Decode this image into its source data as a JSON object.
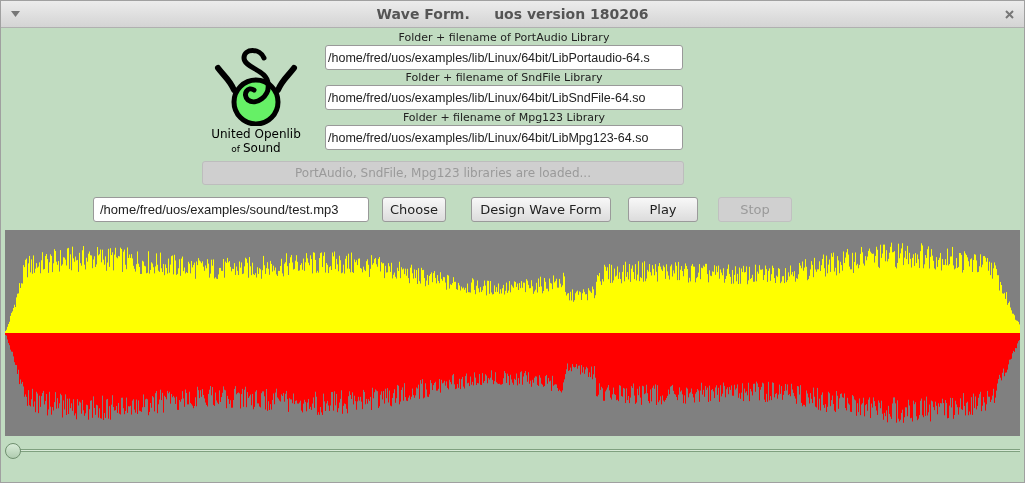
{
  "window": {
    "title": "Wave Form.     uos version 180206"
  },
  "logo": {
    "line_1": "United Openlib",
    "line_2_small": "of",
    "line_2": "Sound"
  },
  "libraries": [
    {
      "label": "Folder + filename of PortAudio Library",
      "value": "/home/fred/uos/examples/lib/Linux/64bit/LibPortaudio-64.s"
    },
    {
      "label": "Folder + filename of SndFile Library",
      "value": "/home/fred/uos/examples/lib/Linux/64bit/LibSndFile-64.so"
    },
    {
      "label": "Folder + filename of Mpg123 Library",
      "value": "/home/fred/uos/examples/lib/Linux/64bit/LibMpg123-64.so"
    }
  ],
  "load_button": {
    "label": "PortAudio, SndFile, Mpg123  libraries are loaded...",
    "disabled": true
  },
  "file_field": {
    "value": "/home/fred/uos/examples/sound/test.mp3"
  },
  "buttons": [
    {
      "label": "Choose",
      "disabled": false
    },
    {
      "label": "Design Wave Form",
      "disabled": false
    },
    {
      "label": "Play",
      "disabled": false
    },
    {
      "label": "Stop",
      "disabled": true
    }
  ],
  "position_slider": {
    "level": 0
  }
}
